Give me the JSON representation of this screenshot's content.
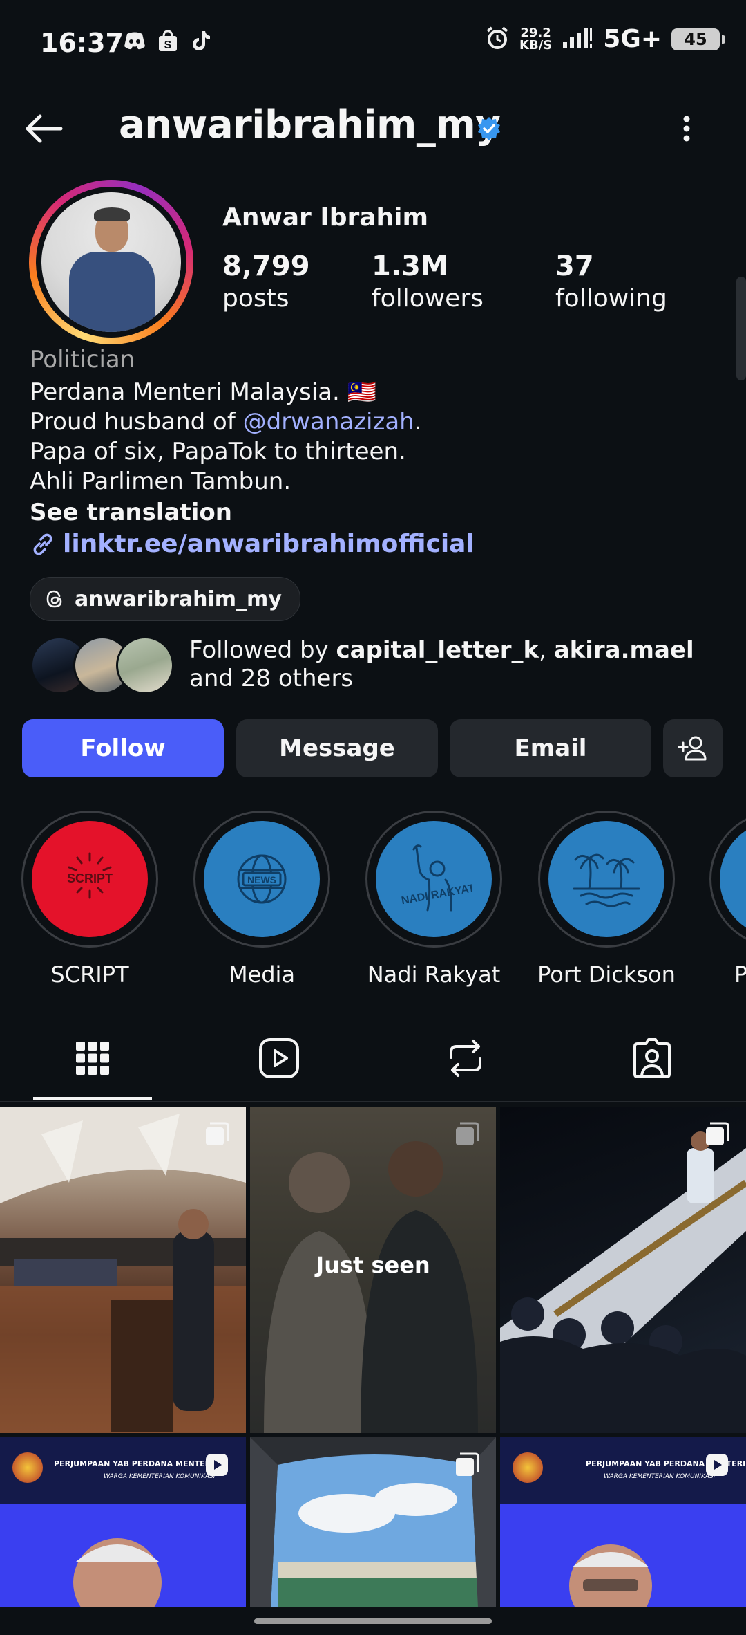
{
  "status_bar": {
    "time": "16:37",
    "net_speed_top": "29.2",
    "net_speed_unit": "KB/S",
    "network": "5G+",
    "battery": "45"
  },
  "header": {
    "username": "anwaribrahim_my",
    "verified_color": "#3897f0"
  },
  "profile": {
    "display_name": "Anwar Ibrahim",
    "stats": [
      {
        "value": "8,799",
        "label": "posts"
      },
      {
        "value": "1.3M",
        "label": "followers"
      },
      {
        "value": "37",
        "label": "following"
      }
    ],
    "category": "Politician",
    "bio": {
      "line1": "Perdana Menteri Malaysia. 🇲🇾",
      "line2_prefix": "Proud husband of ",
      "line2_mention": "@drwanazizah",
      "line2_suffix": ".",
      "line3": "Papa of six, PapaTok to thirteen.",
      "line4": "Ahli Parlimen Tambun."
    },
    "see_translation": "See translation",
    "link": "linktr.ee/anwaribrahimofficial",
    "threads_handle": "anwaribrahim_my",
    "followed_by": {
      "prefix": "Followed by ",
      "user1": "capital_letter_k",
      "sep": ", ",
      "user2": "akira.mael",
      "suffix": " and 28 others"
    }
  },
  "actions": {
    "follow": "Follow",
    "message": "Message",
    "email": "Email",
    "follow_color": "#4a5df9"
  },
  "highlights": [
    {
      "label": "SCRIPT",
      "inner_text": "SCRIPT"
    },
    {
      "label": "Media",
      "inner_text": "NEWS"
    },
    {
      "label": "Nadi Rakyat",
      "inner_text": "NADI RAKYAT"
    },
    {
      "label": "Port Dickson"
    },
    {
      "label": "P"
    }
  ],
  "grid": {
    "just_seen": "Just seen",
    "tile4_banner": "PERJUMPAAN YAB PERDANA MENTERI",
    "tile4_sub": "WARGA KEMENTERIAN KOMUNIKASI",
    "tile6_banner": "PERJUMPAAN YAB PERDANA MENTERI",
    "tile6_sub": "WARGA KEMENTERIAN KOMUNIKASI"
  }
}
